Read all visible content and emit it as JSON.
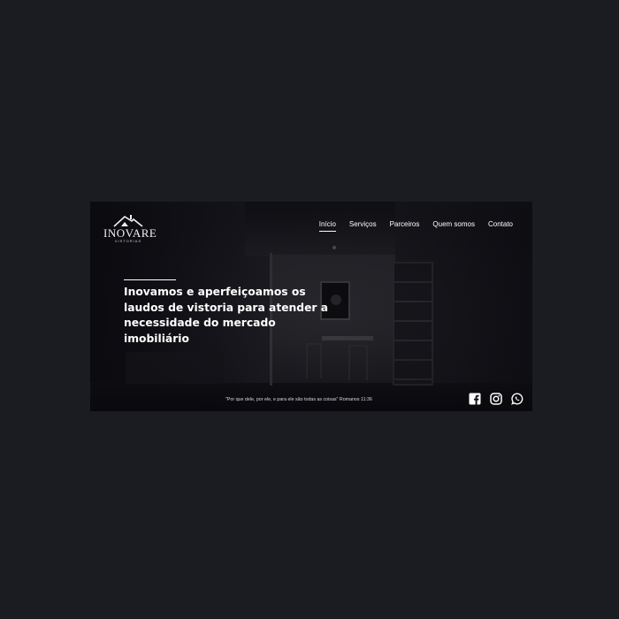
{
  "logo": {
    "name": "INOVARE",
    "subtitle": "VISTORIAS"
  },
  "nav": {
    "items": [
      {
        "label": "Início",
        "active": true
      },
      {
        "label": "Serviços"
      },
      {
        "label": "Parceiros"
      },
      {
        "label": "Quem somos"
      },
      {
        "label": "Contato"
      }
    ]
  },
  "hero": {
    "title": "Inovamos e aperfeiçoamos os laudos de vistoria para atender a necessidade do mercado imobiliário"
  },
  "footer": {
    "quote": "\"Por que dele, por ele, e para ele são todas as coisas\" Romanos 11:36",
    "social": [
      "facebook-icon",
      "instagram-icon",
      "whatsapp-icon"
    ]
  },
  "colors": {
    "page_bg": "#1b1c21",
    "text": "#ffffff"
  }
}
